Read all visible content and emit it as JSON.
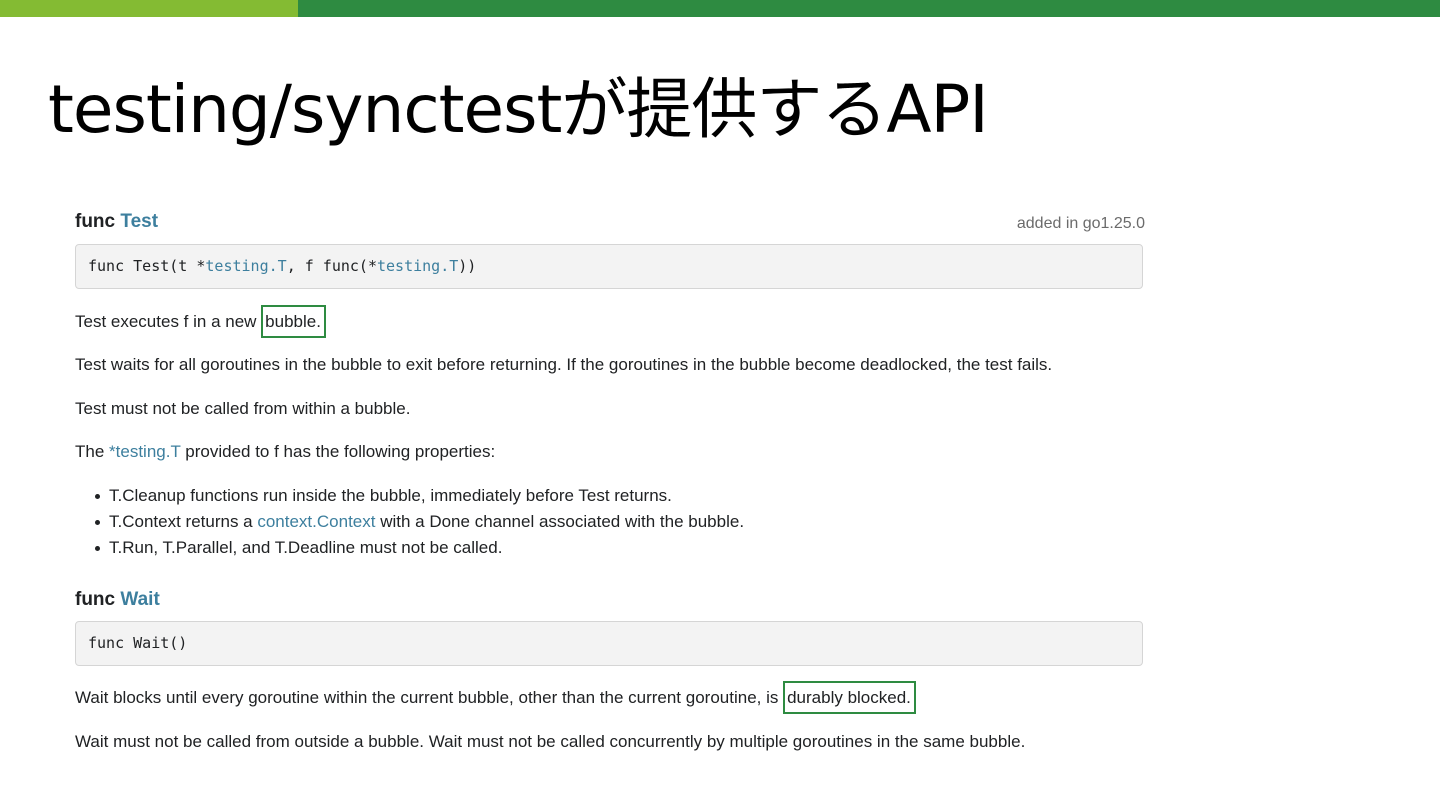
{
  "slide": {
    "title": "testing/synctestが提供するAPI",
    "colors": {
      "bar_light": "#84bb33",
      "bar_dark": "#2e8b41",
      "highlight": "#2e8b41",
      "link": "#3d7f9e"
    }
  },
  "doc": {
    "test": {
      "keyword": "func",
      "name": "Test",
      "since": "added in go1.25.0",
      "signature": {
        "part1": "func Test(t *",
        "link1": "testing.T",
        "part2": ", f func(*",
        "link2": "testing.T",
        "part3": "))"
      },
      "p1_text": "Test executes f in a new ",
      "p1_highlight": "bubble.",
      "p2": "Test waits for all goroutines in the bubble to exit before returning. If the goroutines in the bubble become deadlocked, the test fails.",
      "p3": "Test must not be called from within a bubble.",
      "p4_before": "The ",
      "p4_link": "*testing.T",
      "p4_after": " provided to f has the following properties:",
      "bullets": {
        "b1": "T.Cleanup functions run inside the bubble, immediately before Test returns.",
        "b2_before": "T.Context returns a ",
        "b2_link": "context.Context",
        "b2_after": " with a Done channel associated with the bubble.",
        "b3": "T.Run, T.Parallel, and T.Deadline must not be called."
      }
    },
    "wait": {
      "keyword": "func",
      "name": "Wait",
      "signature": "func Wait()",
      "p1_text": "Wait blocks until every goroutine within the current bubble, other than the current goroutine, is ",
      "p1_highlight": "durably blocked.",
      "p2": "Wait must not be called from outside a bubble. Wait must not be called concurrently by multiple goroutines in the same bubble."
    }
  }
}
